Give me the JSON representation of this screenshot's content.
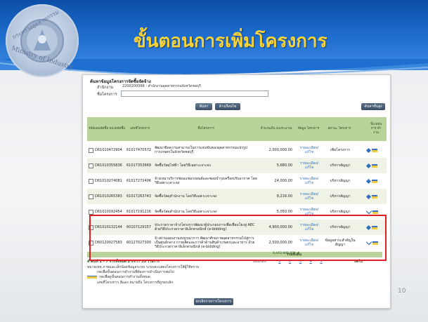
{
  "slide": {
    "title": "ขั้นตอนการเพิ่มโครงการ",
    "seal_text": "กระทรวงอุตสาหกรรม Ministry of Industry",
    "page_number": "10"
  },
  "panel": {
    "heading": "ค้นหาข้อมูลโครงการจัดซื้อจัดจ้าง",
    "agency_label": "สำนักงาน",
    "agency_value": "2200200066 : สำนักงานอุตสาหกรรมจังหวัดชลบุรี",
    "project_label": "ชื่อโครงการ",
    "project_value": "",
    "search_button": "ค้นหา",
    "clear_button": "ล้างเงื่อนไข",
    "add_button": "ค้นหาขั้นสูง"
  },
  "table": {
    "headers": [
      "รหัสแผนจัดซื้อ หน่วยจัดซื้อ",
      "เลขที่โครงการ",
      "ชื่อโครงการ",
      "จำนวนเงิน งบประมาณ",
      "ข้อมูล โครงการ",
      "สถานะ โครงการ",
      "ขั้น ตอน การ ทำ งาน"
    ],
    "rows": [
      {
        "plan": "D61010472904",
        "project_no": "61017470572",
        "name": "พัฒนาขีดความสามารถในการแข่งขันของอุตสาหกรรมแปรรูปการเกษตรในจังหวัดชลบุรี",
        "amount": "2,000,000.00",
        "info": "รายละเอียด/แก้ไข",
        "status": "เพิ่มโครงการ",
        "step": "pin"
      },
      {
        "plan": "D61010355836",
        "project_no": "61017353669",
        "name": "จัดซื้อวัสดุไฟฟ้า โดยวิธีเฉพาะเจาะจง",
        "amount": "5,680.00",
        "info": "รายละเอียด/แก้ไข",
        "status": "บริหารสัญญา",
        "step": "pin"
      },
      {
        "plan": "D61010274081",
        "project_no": "61017272406",
        "name": "จ้างเหมาบริการซ่อมแซมรถยนต์และซ่อมบำรุงเครื่องปรับอากาศ โดยวิธีเฉพาะเจาะจง",
        "amount": "24,000.00",
        "info": "รายละเอียด/แก้ไข",
        "status": "บริหารสัญญา",
        "step": "pin"
      },
      {
        "plan": "D61010265383",
        "project_no": "61017263743",
        "name": "จัดซื้อวัสดุสำนักงาน โดยวิธีเฉพาะเจาะจง",
        "amount": "8,216.00",
        "info": "รายละเอียด/แก้ไข",
        "status": "บริหารสัญญา",
        "step": "pin"
      },
      {
        "plan": "D61010192454",
        "project_no": "61017191216",
        "name": "จัดซื้อวัสดุสำนักงาน โดยวิธีเฉพาะเจาะจง",
        "amount": "5,050.00",
        "info": "รายละเอียด/แก้ไข",
        "status": "บริหารสัญญา",
        "step": "check"
      },
      {
        "plan": "D61010132144",
        "project_no": "60107129157",
        "name": "ประกวดราคาจ้างโครงการพัฒนาผู้ประกอบการเพื่อเชื่อมโยงสู่ AEC ด้วยวิธีประกวดราคาอิเล็กทรอนิกส์ (e-bidding)",
        "amount": "4,900,000.00",
        "info": "รายละเอียด/แก้ไข",
        "status": "บริหารสัญญา",
        "step": "pin"
      },
      {
        "plan": "D60120027583",
        "project_no": "60127027300",
        "name": "จ้างผ่านแผนงานงบบูรณาการ พัฒนาศักยภาพอุตสาหกรรมไปสู่การเป็นศูนย์กลาง การผลิตและการค้าด้านสินค้าเกษตรและอาหาร ด้วยวิธีประกวดราคาอิเล็กทรอนิกส์ (e-bidding)",
        "amount": "2,500,000.00",
        "info": "รายละเอียด/แก้ไข",
        "status": "ข้อมูลสาระสำคัญในสัญญา",
        "step": "check"
      }
    ]
  },
  "footer": {
    "total_label": "รวมทั้งสิ้น",
    "total_value": "9,443,946.00",
    "paging": "ลำดับที่ 1 - 7 จากทั้งหมด มากกว่า 35 รายการ",
    "previous": "ย้อนกลับ",
    "pages": [
      "1",
      "2",
      "3",
      "4",
      "5"
    ],
    "next": "ถัดไป",
    "note1": "หมายเหตุ ภาพและเล็กน้อยข้อมูลระบบ ระบบจะแสดงโครงการให้ผู้ใช้ทราบ",
    "note2": "กดเพื่อขั้นตอนการทำงานที่ต้องการดำเนินการต่อไป",
    "note3": "กดเพื่อดูขั้นตอนการทำงานทั้งหมด",
    "note4": "เลขที่โครงการ สีแดง หมายถึง โครงการที่ถูกยกเลิก",
    "back_button": "ยกเลิกรายการโครงการ"
  },
  "colors": {
    "highlight": "#e01d25",
    "title": "#f7d33a",
    "table_header": "#b9d39b"
  }
}
